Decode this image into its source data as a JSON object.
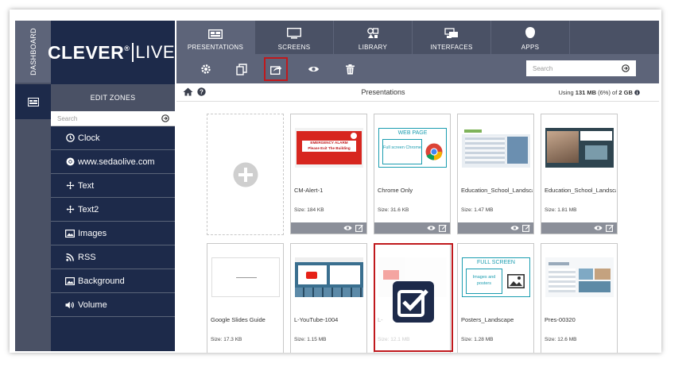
{
  "dashboard": {
    "label": "DASHBOARD"
  },
  "logo": {
    "brand": "CLEVER",
    "reg": "®",
    "live": "LIVE"
  },
  "sidebar": {
    "header": "EDIT ZONES",
    "search_placeholder": "Search",
    "items": [
      {
        "label": "Clock",
        "icon": "clock-icon"
      },
      {
        "label": "www.sedaolive.com",
        "icon": "chrome-icon"
      },
      {
        "label": "Text",
        "icon": "move-icon"
      },
      {
        "label": "Text2",
        "icon": "move-icon"
      },
      {
        "label": "Images",
        "icon": "image-icon"
      },
      {
        "label": "RSS",
        "icon": "rss-icon"
      },
      {
        "label": "Background",
        "icon": "image-icon"
      },
      {
        "label": "Volume",
        "icon": "volume-icon"
      }
    ]
  },
  "nav": {
    "tabs": [
      {
        "label": "PRESENTATIONS",
        "icon": "presentations-icon",
        "active": true
      },
      {
        "label": "SCREENS",
        "icon": "screens-icon",
        "active": false
      },
      {
        "label": "LIBRARY",
        "icon": "library-icon",
        "active": false
      },
      {
        "label": "INTERFACES",
        "icon": "interfaces-icon",
        "active": false
      },
      {
        "label": "APPS",
        "icon": "apps-icon",
        "active": false
      }
    ]
  },
  "toolbar": {
    "search_placeholder": "Search",
    "buttons": [
      "settings-icon",
      "duplicate-icon",
      "share-icon",
      "preview-icon",
      "delete-icon"
    ]
  },
  "content": {
    "title": "Presentations",
    "usage_prefix": "Using ",
    "usage_used": "131 MB",
    "usage_mid": " (6%) of ",
    "usage_total": "2 GB"
  },
  "cards": [
    {
      "name": "CM-Alert-1",
      "size": "Size: 184 KB",
      "thumb_alarm": "EMERGENCY ALARM",
      "thumb_alarm2": "Please Exit The Building"
    },
    {
      "name": "Chrome Only",
      "size": "Size: 31.6 KB",
      "thumb_title": "WEB PAGE",
      "thumb_text": "Full screen Chrome"
    },
    {
      "name": "Education_School_Landscape",
      "size": "Size: 1.47 MB"
    },
    {
      "name": "Education_School_Landscape",
      "size": "Size: 1.81 MB"
    },
    {
      "name": "Google Slides Guide",
      "size": "Size: 17.3 KB"
    },
    {
      "name": "L-YouTube-1004",
      "size": "Size: 1.15 MB"
    },
    {
      "name": "L-",
      "size": "Size: 12.1 MB"
    },
    {
      "name": "Posters_Landscape",
      "size": "Size: 1.28 MB",
      "thumb_title": "FULL SCREEN",
      "thumb_text": "Images and posters"
    },
    {
      "name": "Pres-00320",
      "size": "Size: 12.6 MB"
    }
  ],
  "colors": {
    "navy": "#1d2a4a",
    "slate": "#4a5165",
    "highlight": "#c0191d"
  }
}
